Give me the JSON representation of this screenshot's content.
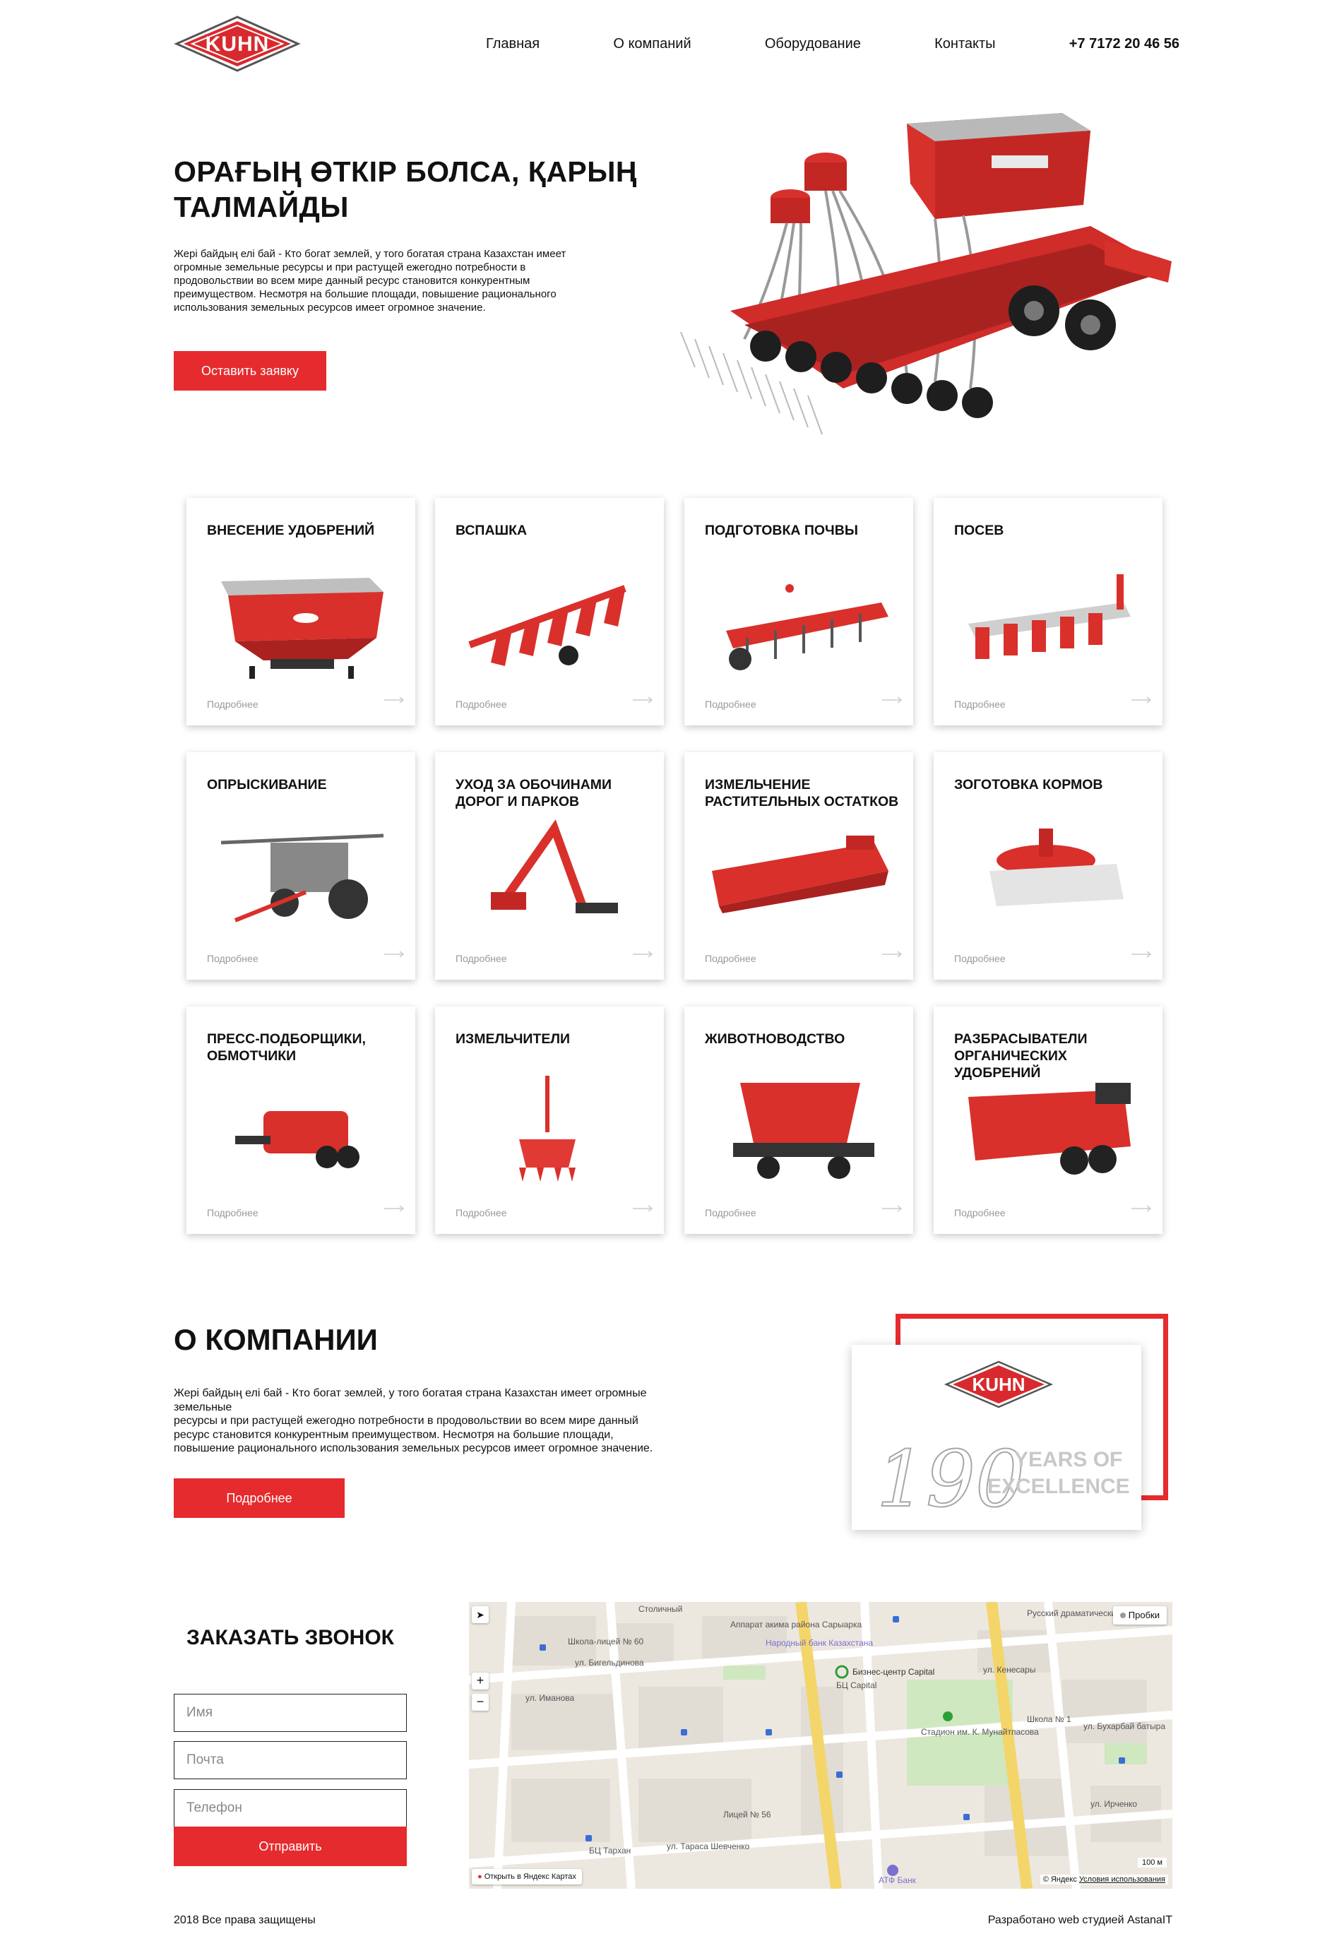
{
  "header": {
    "logo_text": "KUHN",
    "nav": [
      "Главная",
      "О компаний",
      "Оборудование",
      "Контакты"
    ],
    "phone": "+7 7172 20 46 56"
  },
  "hero": {
    "title_line1": "ОРАҒЫҢ ӨТКІР БОЛСА, ҚАРЫҢ",
    "title_line2": "ТАЛМАЙДЫ",
    "text_lines": [
      "Жері байдың елі бай - Кто богат землей, у того богатая страна Казахстан имеет",
      "огромные земельные ресурсы и при растущей ежегодно потребности в",
      "продовольствии во всем мире данный ресурс становится конкурентным",
      "преимуществом. Несмотря на большие площади, повышение рационального",
      "использования земельных ресурсов имеет огромное значение."
    ],
    "button": "Оставить заявку"
  },
  "categories": [
    {
      "title": "ВНЕСЕНИЕ УДОБРЕНИЙ",
      "more": "Подробнее",
      "icon": "spreader-image"
    },
    {
      "title": "ВСПАШКА",
      "more": "Подробнее",
      "icon": "plough-image"
    },
    {
      "title": "ПОДГОТОВКА ПОЧВЫ",
      "more": "Подробнее",
      "icon": "cultivator-image"
    },
    {
      "title": "ПОСЕВ",
      "more": "Подробнее",
      "icon": "planter-image"
    },
    {
      "title": "ОПРЫСКИВАНИЕ",
      "more": "Подробнее",
      "icon": "sprayer-image"
    },
    {
      "title": "УХОД ЗА ОБОЧИНАМИ ДОРОГ И ПАРКОВ",
      "more": "Подробнее",
      "icon": "hedge-cutter-image"
    },
    {
      "title": "ИЗМЕЛЬЧЕНИЕ РАСТИТЕЛЬНЫХ ОСТАТКОВ",
      "more": "Подробнее",
      "icon": "mulcher-image"
    },
    {
      "title": "ЗОГОТОВКА КОРМОВ",
      "more": "Подробнее",
      "icon": "mower-image"
    },
    {
      "title": "ПРЕСС-ПОДБОРЩИКИ, ОБМОТЧИКИ",
      "more": "Подробнее",
      "icon": "baler-image"
    },
    {
      "title": "ИЗМЕЛЬЧИТЕЛИ",
      "more": "Подробнее",
      "icon": "shredder-image"
    },
    {
      "title": "ЖИВОТНОВОДСТВО",
      "more": "Подробнее",
      "icon": "feed-mixer-image"
    },
    {
      "title": "РАЗБРАСЫВАТЕЛИ ОРГАНИЧЕСКИХ УДОБРЕНИЙ",
      "more": "Подробнее",
      "icon": "manure-spreader-image"
    }
  ],
  "about": {
    "title": "О КОМПАНИИ",
    "text_lines": [
      "Жері байдың елі бай - Кто богат землей, у того богатая страна Казахстан имеет огромные земельные",
      "ресурсы и при растущей ежегодно потребности в продовольствии во всем мире данный",
      "ресурс становится конкурентным преимуществом. Несмотря на большие площади,",
      "повышение рационального использования земельных ресурсов имеет огромное значение."
    ],
    "button": "Подробнее",
    "badge_logo": "KUHN",
    "badge_years": "190",
    "badge_line1": "YEARS OF",
    "badge_line2": "EXCELLENCE"
  },
  "callback": {
    "title": "ЗАКАЗАТЬ ЗВОНОК",
    "name_placeholder": "Имя",
    "email_placeholder": "Почта",
    "phone_placeholder": "Телефон",
    "button": "Отправить"
  },
  "map": {
    "traffic_button": "Пробки",
    "open_link": "Открыть в Яндекс Картах",
    "scale": "100 м",
    "copyright": "© Яндекс",
    "terms": "Условия использования",
    "labels": [
      "Бизнес-центр Capital",
      "ул. Кенесары",
      "Стадион им. К. Мунайтпасова",
      "ул. Бигельдинова",
      "Школа-лицей № 60",
      "ул. Иманова",
      "БЦ Тархан",
      "ул. Тараса Шевченко",
      "Лицей № 56",
      "Народный банк Казахстана",
      "Аппарат акима района Сарыарка",
      "ул. Бухарбай батыра",
      "АТФ Банк",
      "Школа № 1",
      "Русский драматический театр",
      "ул. Ирченко",
      "Столичный",
      "БЦ Capital"
    ]
  },
  "footer": {
    "left": "2018 Все права защищены",
    "right": "Разработано web студией AstanaIT"
  },
  "colors": {
    "accent": "#e52b2e",
    "text": "#111111",
    "muted": "#999999"
  }
}
